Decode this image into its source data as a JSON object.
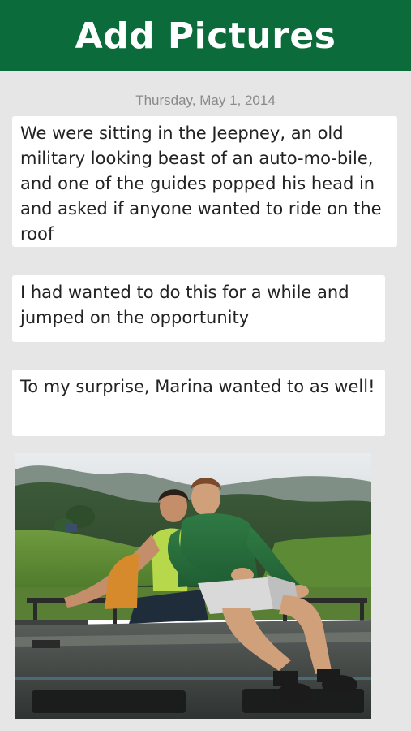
{
  "header": {
    "title": "Add Pictures"
  },
  "post": {
    "date": "Thursday, May 1, 2014",
    "messages": [
      "We were sitting in the Jeepney, an old military looking beast of an auto-mo-bile, and one of the guides popped his head in and asked if anyone wanted to ride on the roof",
      "I had  wanted to do this for a while and jumped on the opportunity",
      "To my surprise, Marina wanted to as well!"
    ]
  },
  "colors": {
    "header_bg": "#0b6b3a",
    "page_bg": "#e6e6e6",
    "bubble_bg": "#ffffff",
    "date_text": "#8a8a8a"
  }
}
